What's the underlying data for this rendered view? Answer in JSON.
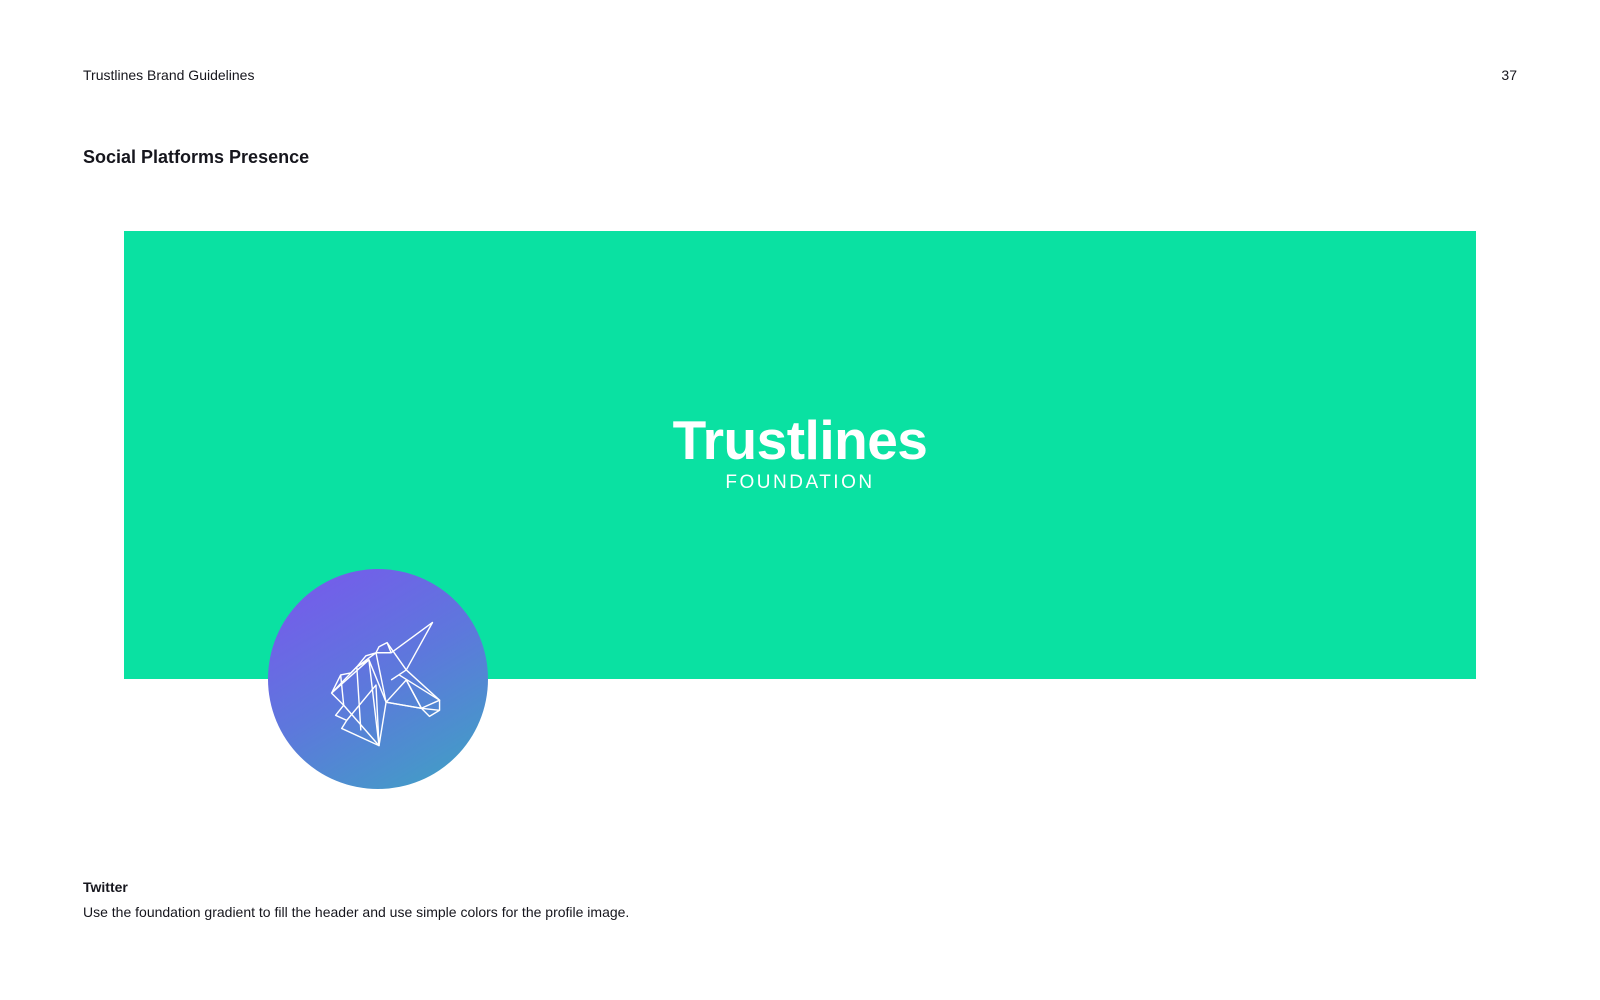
{
  "header": {
    "doc_title": "Trustlines Brand Guidelines",
    "page_number": "37"
  },
  "section_title": "Social Platforms Presence",
  "banner": {
    "brand_name": "Trustlines",
    "brand_sub": "FOUNDATION",
    "color": "#0ae1a2"
  },
  "avatar": {
    "icon": "unicorn-icon",
    "gradient": [
      "#7a56ee",
      "#3da4c2"
    ]
  },
  "twitter": {
    "title": "Twitter",
    "description": "Use the foundation gradient to fill the header and use simple colors for the profile image."
  }
}
